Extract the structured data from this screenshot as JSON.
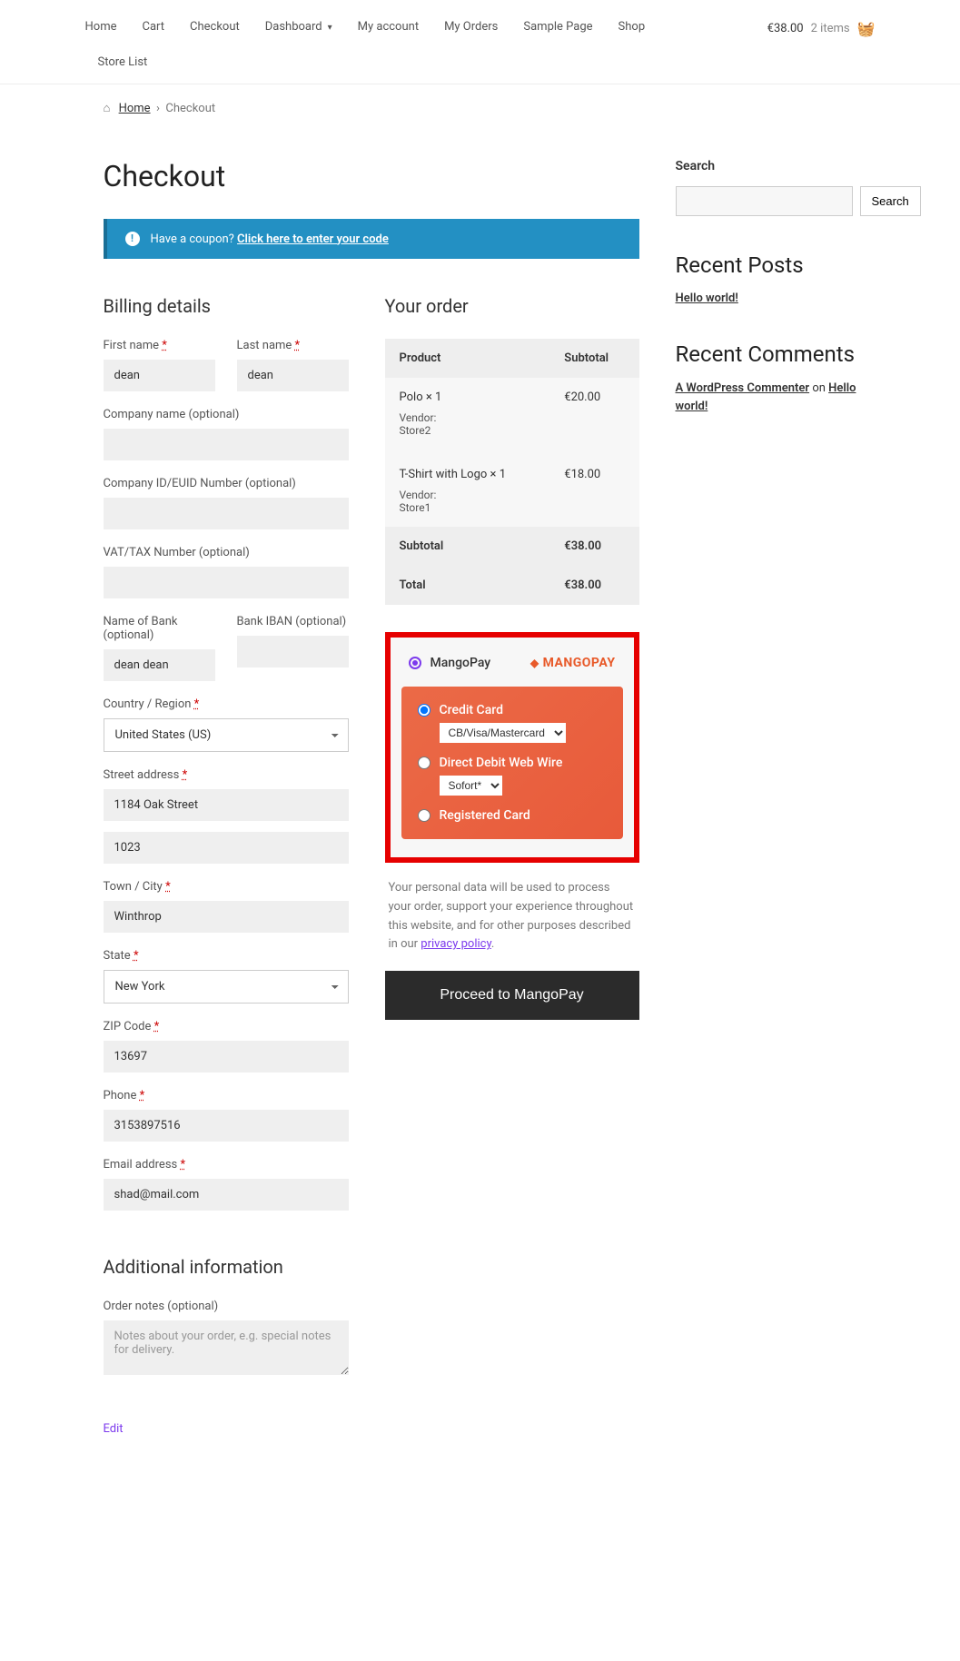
{
  "nav": {
    "items": [
      "Home",
      "Cart",
      "Checkout",
      "Dashboard",
      "My account",
      "My Orders",
      "Sample Page",
      "Shop",
      "Store List"
    ]
  },
  "cart": {
    "total": "€38.00",
    "items": "2 items"
  },
  "breadcrumb": {
    "home": "Home",
    "current": "Checkout"
  },
  "page_title": "Checkout",
  "coupon": {
    "text": "Have a coupon?",
    "link": "Click here to enter your code"
  },
  "billing": {
    "title": "Billing details",
    "first_name": {
      "label": "First name",
      "value": "dean"
    },
    "last_name": {
      "label": "Last name",
      "value": "dean"
    },
    "company": {
      "label": "Company name (optional)",
      "value": ""
    },
    "company_id": {
      "label": "Company ID/EUID Number (optional)",
      "value": ""
    },
    "vat": {
      "label": "VAT/TAX Number (optional)",
      "value": ""
    },
    "bank_name": {
      "label": "Name of Bank (optional)",
      "value": "dean dean"
    },
    "bank_iban": {
      "label": "Bank IBAN (optional)",
      "value": ""
    },
    "country": {
      "label": "Country / Region",
      "value": "United States (US)"
    },
    "street": {
      "label": "Street address",
      "value": "1184 Oak Street",
      "value2": "1023"
    },
    "city": {
      "label": "Town / City",
      "value": "Winthrop"
    },
    "state": {
      "label": "State",
      "value": "New York"
    },
    "zip": {
      "label": "ZIP Code",
      "value": "13697"
    },
    "phone": {
      "label": "Phone",
      "value": "3153897516"
    },
    "email": {
      "label": "Email address",
      "value": "shad@mail.com"
    }
  },
  "additional": {
    "title": "Additional information",
    "notes_label": "Order notes (optional)",
    "notes_placeholder": "Notes about your order, e.g. special notes for delivery."
  },
  "edit_link": "Edit",
  "order": {
    "title": "Your order",
    "th_product": "Product",
    "th_subtotal": "Subtotal",
    "items": [
      {
        "name": "Polo  × 1",
        "vendor_label": "Vendor:",
        "vendor": "Store2",
        "subtotal": "€20.00"
      },
      {
        "name": "T-Shirt with Logo  × 1",
        "vendor_label": "Vendor:",
        "vendor": "Store1",
        "subtotal": "€18.00"
      }
    ],
    "subtotal_label": "Subtotal",
    "subtotal": "€38.00",
    "total_label": "Total",
    "total": "€38.00"
  },
  "payment": {
    "provider": "MangoPay",
    "logo": "MANGOPAY",
    "options": {
      "cc_label": "Credit Card",
      "cc_select": "CB/Visa/Mastercard",
      "dd_label": "Direct Debit Web Wire",
      "dd_select": "Sofort*",
      "reg_label": "Registered Card"
    },
    "privacy": "Your personal data will be used to process your order, support your experience throughout this website, and for other purposes described in our ",
    "privacy_link": "privacy policy",
    "button": "Proceed to MangoPay"
  },
  "sidebar": {
    "search_title": "Search",
    "search_btn": "Search",
    "recent_posts_title": "Recent Posts",
    "recent_post": "Hello world!",
    "recent_comments_title": "Recent Comments",
    "commenter": "A WordPress Commenter",
    "on": " on ",
    "comment_post": "Hello world!"
  }
}
